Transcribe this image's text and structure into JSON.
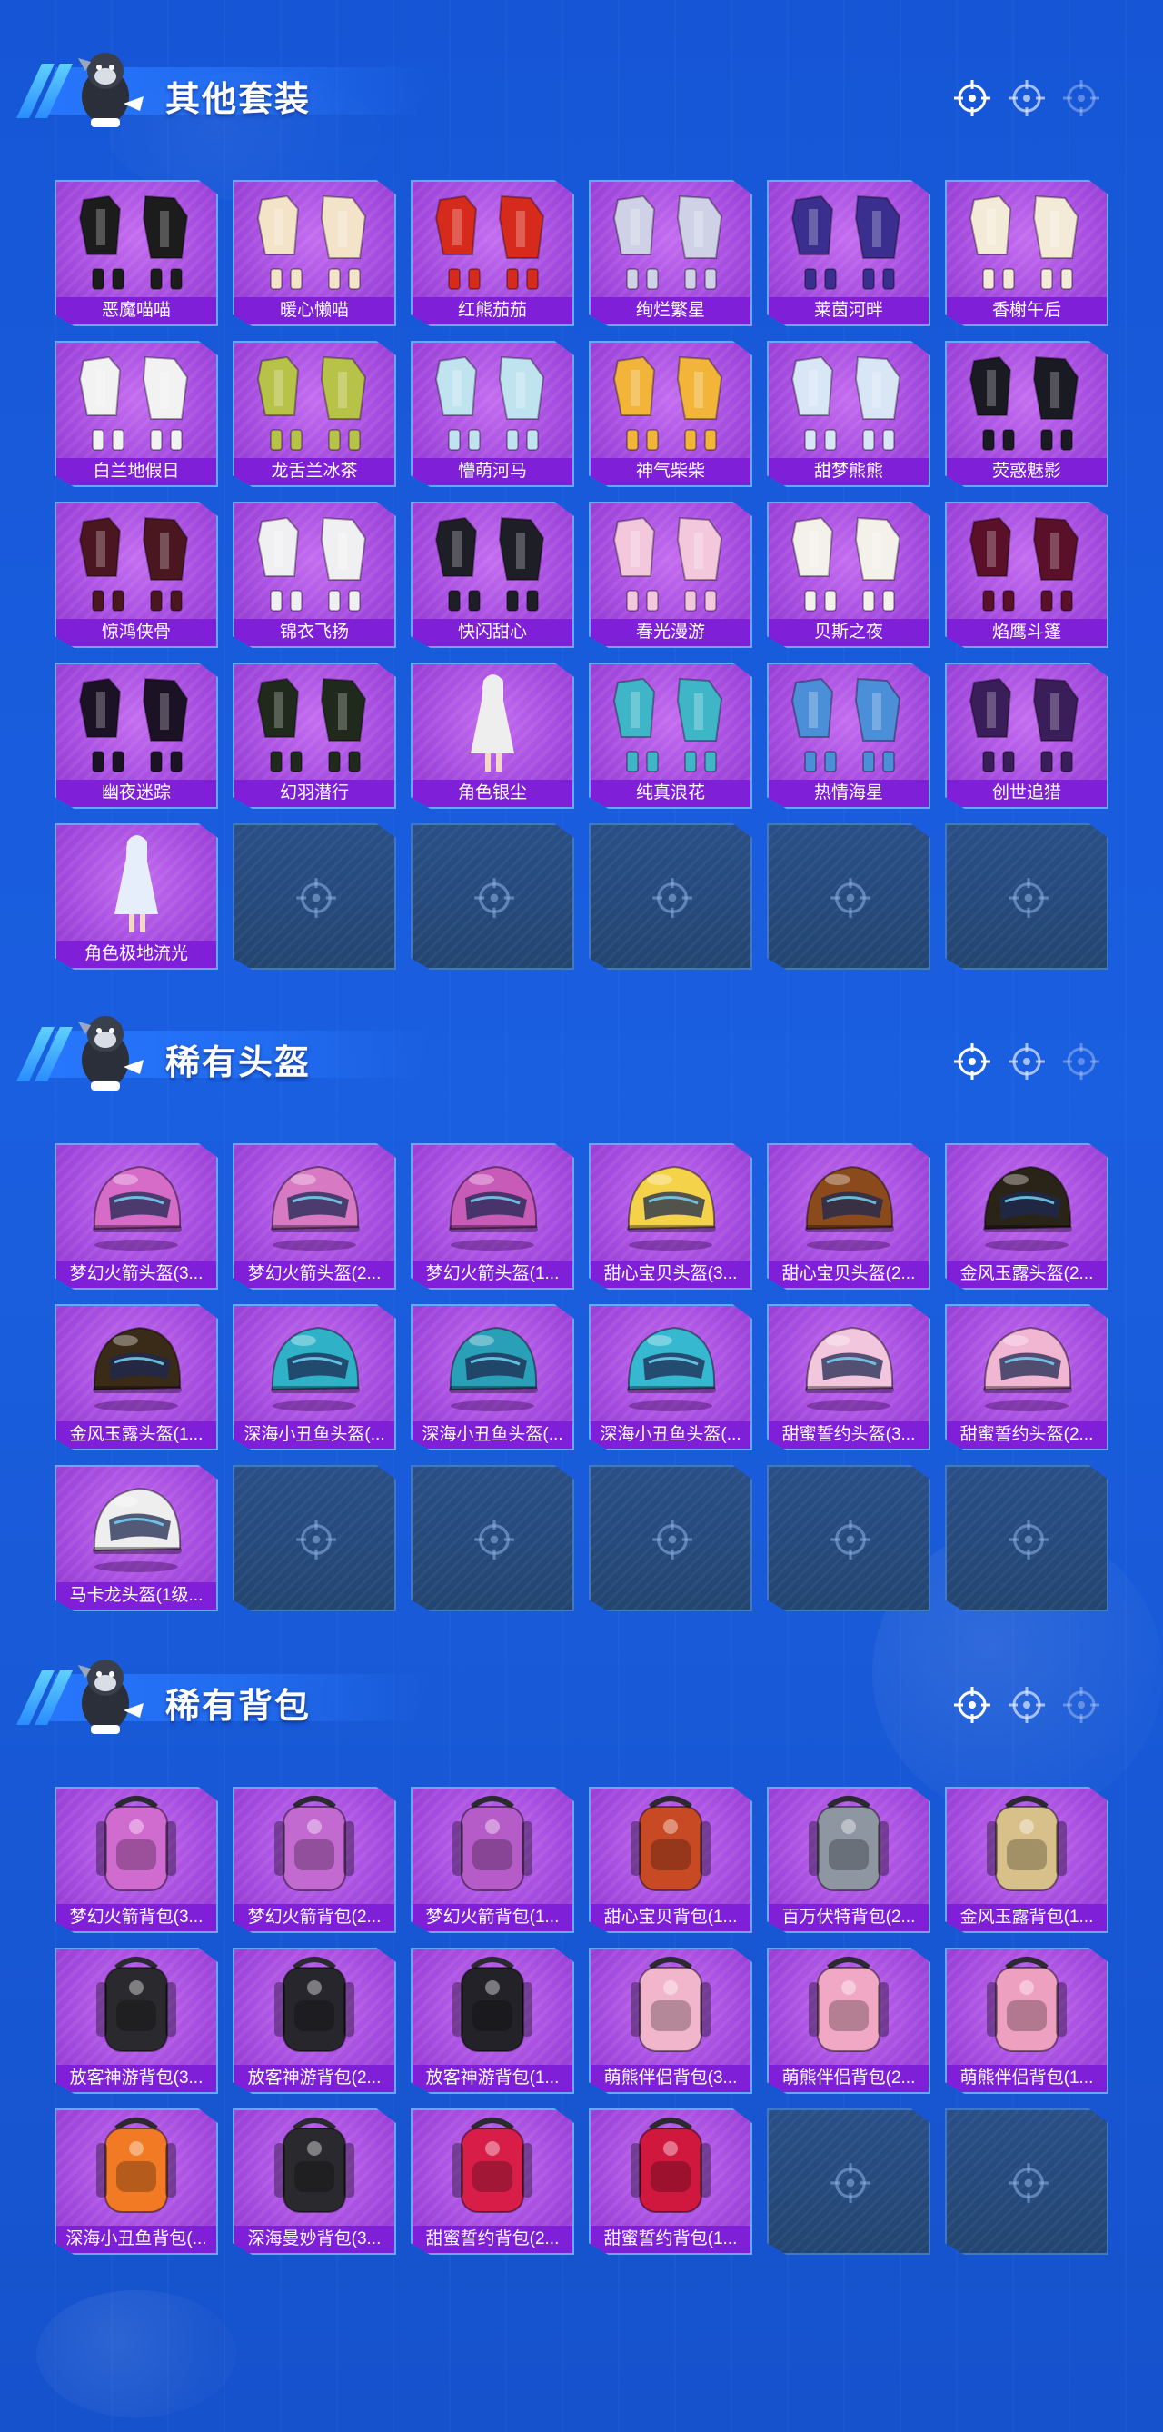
{
  "colors": {
    "background": "#1a5fe0",
    "tile_purple": "#a64de0",
    "label_bar": "#7f1fd8",
    "empty_tile": "#2a4f86",
    "tile_border": "#67a8ff"
  },
  "sections": [
    {
      "title": "其他套装",
      "kind": "outfit",
      "items": [
        {
          "label": "恶魔喵喵",
          "icon": "outfit-icon",
          "color": "#1c1c1c"
        },
        {
          "label": "暖心懒喵",
          "icon": "outfit-icon",
          "color": "#f3e3c8"
        },
        {
          "label": "红熊茄茄",
          "icon": "outfit-icon",
          "color": "#d62a1c"
        },
        {
          "label": "绚烂繁星",
          "icon": "outfit-icon",
          "color": "#cfd2e6"
        },
        {
          "label": "莱茵河畔",
          "icon": "outfit-icon",
          "color": "#3a2f8f"
        },
        {
          "label": "香榭午后",
          "icon": "outfit-icon",
          "color": "#f4ead8"
        },
        {
          "label": "白兰地假日",
          "icon": "outfit-icon",
          "color": "#f2f2f2"
        },
        {
          "label": "龙舌兰冰茶",
          "icon": "outfit-icon",
          "color": "#b6c248"
        },
        {
          "label": "懵萌河马",
          "icon": "outfit-icon",
          "color": "#bfe3ef"
        },
        {
          "label": "神气柴柴",
          "icon": "outfit-icon",
          "color": "#f2b53a"
        },
        {
          "label": "甜梦熊熊",
          "icon": "outfit-icon",
          "color": "#d8e6f6"
        },
        {
          "label": "荧惑魅影",
          "icon": "outfit-icon",
          "color": "#1a1a22"
        },
        {
          "label": "惊鸿侠骨",
          "icon": "outfit-icon",
          "color": "#4a1620"
        },
        {
          "label": "锦衣飞扬",
          "icon": "outfit-icon",
          "color": "#f0f0f2"
        },
        {
          "label": "快闪甜心",
          "icon": "outfit-icon",
          "color": "#1e1e26"
        },
        {
          "label": "春光漫游",
          "icon": "outfit-icon",
          "color": "#f3c8dc"
        },
        {
          "label": "贝斯之夜",
          "icon": "outfit-icon",
          "color": "#f4f0ea"
        },
        {
          "label": "焰鹰斗篷",
          "icon": "outfit-icon",
          "color": "#5a1028"
        },
        {
          "label": "幽夜迷踪",
          "icon": "outfit-icon",
          "color": "#1c1226"
        },
        {
          "label": "幻羽潜行",
          "icon": "outfit-icon",
          "color": "#1f2a1c"
        },
        {
          "label": "角色银尘",
          "icon": "character-icon",
          "color": "#eeeeee"
        },
        {
          "label": "纯真浪花",
          "icon": "outfit-icon",
          "color": "#3fb6c8"
        },
        {
          "label": "热情海星",
          "icon": "outfit-icon",
          "color": "#4a8fd8"
        },
        {
          "label": "创世追猎",
          "icon": "outfit-icon",
          "color": "#3a1e5a"
        },
        {
          "label": "角色极地流光",
          "icon": "character-icon",
          "color": "#e6eefc"
        }
      ],
      "empty_slots": 5
    },
    {
      "title": "稀有头盔",
      "kind": "helmet",
      "items": [
        {
          "label": "梦幻火箭头盔(3...",
          "icon": "helmet-icon",
          "color": "#d66bc8"
        },
        {
          "label": "梦幻火箭头盔(2...",
          "icon": "helmet-icon",
          "color": "#d879c4"
        },
        {
          "label": "梦幻火箭头盔(1...",
          "icon": "helmet-icon",
          "color": "#c85ab8"
        },
        {
          "label": "甜心宝贝头盔(3...",
          "icon": "helmet-icon",
          "color": "#f4d24a"
        },
        {
          "label": "甜心宝贝头盔(2...",
          "icon": "helmet-icon",
          "color": "#8a4a1c"
        },
        {
          "label": "金风玉露头盔(2...",
          "icon": "helmet-icon",
          "color": "#2a2418"
        },
        {
          "label": "金风玉露头盔(1...",
          "icon": "helmet-icon",
          "color": "#3a2a18"
        },
        {
          "label": "深海小丑鱼头盔(...",
          "icon": "helmet-icon",
          "color": "#2fb2c8"
        },
        {
          "label": "深海小丑鱼头盔(...",
          "icon": "helmet-icon",
          "color": "#2a9fb8"
        },
        {
          "label": "深海小丑鱼头盔(...",
          "icon": "helmet-icon",
          "color": "#35b8d0"
        },
        {
          "label": "甜蜜誓约头盔(3...",
          "icon": "helmet-icon",
          "color": "#f2c6dc"
        },
        {
          "label": "甜蜜誓约头盔(2...",
          "icon": "helmet-icon",
          "color": "#f0b6d2"
        },
        {
          "label": "马卡龙头盔(1级...",
          "icon": "helmet-icon",
          "color": "#eeeeee"
        }
      ],
      "empty_slots": 5
    },
    {
      "title": "稀有背包",
      "kind": "backpack",
      "items": [
        {
          "label": "梦幻火箭背包(3...",
          "icon": "backpack-icon",
          "color": "#d06bd0"
        },
        {
          "label": "梦幻火箭背包(2...",
          "icon": "backpack-icon",
          "color": "#c26ad0"
        },
        {
          "label": "梦幻火箭背包(1...",
          "icon": "backpack-icon",
          "color": "#b65cc8"
        },
        {
          "label": "甜心宝贝背包(1...",
          "icon": "backpack-icon",
          "color": "#c84a24"
        },
        {
          "label": "百万伏特背包(2...",
          "icon": "backpack-icon",
          "color": "#8e96a2"
        },
        {
          "label": "金风玉露背包(1...",
          "icon": "backpack-icon",
          "color": "#d8c08a"
        },
        {
          "label": "放客神游背包(3...",
          "icon": "backpack-icon",
          "color": "#2a2a2e"
        },
        {
          "label": "放客神游背包(2...",
          "icon": "backpack-icon",
          "color": "#26262c"
        },
        {
          "label": "放客神游背包(1...",
          "icon": "backpack-icon",
          "color": "#222228"
        },
        {
          "label": "萌熊伴侣背包(3...",
          "icon": "backpack-icon",
          "color": "#f2b6cc"
        },
        {
          "label": "萌熊伴侣背包(2...",
          "icon": "backpack-icon",
          "color": "#f0a8c4"
        },
        {
          "label": "萌熊伴侣背包(1...",
          "icon": "backpack-icon",
          "color": "#eea0c0"
        },
        {
          "label": "深海小丑鱼背包(...",
          "icon": "backpack-icon",
          "color": "#f27a24"
        },
        {
          "label": "深海曼妙背包(3...",
          "icon": "backpack-icon",
          "color": "#2a2a2e"
        },
        {
          "label": "甜蜜誓约背包(2...",
          "icon": "backpack-icon",
          "color": "#d81e48"
        },
        {
          "label": "甜蜜誓约背包(1...",
          "icon": "backpack-icon",
          "color": "#d0183e"
        }
      ],
      "empty_slots": 2
    }
  ]
}
